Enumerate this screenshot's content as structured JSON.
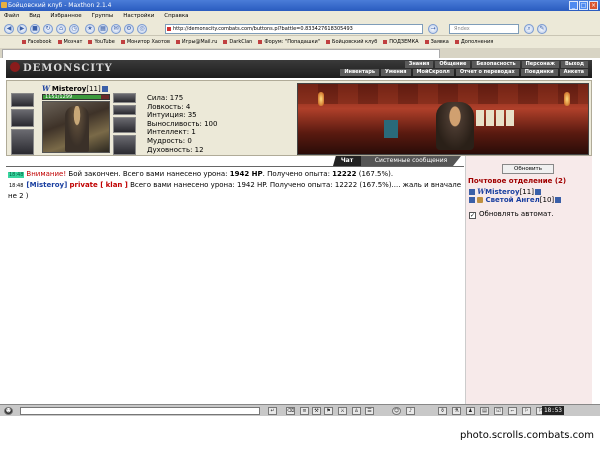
{
  "browser": {
    "title": "Бойцовский клуб - Maxthon 2.1.4",
    "menu": [
      "Файл",
      "Вид",
      "Избранное",
      "Группы",
      "Настройки",
      "Справка"
    ],
    "address": "http://demonscity.combats.com/buttons.pl?battle=0.833427618305493",
    "search_placeholder": "Яndex",
    "bookmarks": [
      "Facebook",
      "Мозчат",
      "YouTube",
      "Монитор Хаотов",
      "Игры@Mail.ru",
      "DarkClan",
      "Форум: \"Попадашки\"",
      "Бойцовский клуб",
      "ПОДЗЕМКА",
      "Заявка",
      "Дополнения"
    ]
  },
  "game": {
    "logo": "DEMONSCITY",
    "nav_row1": [
      "Знания",
      "Общение",
      "Безопасность",
      "Персонаж",
      "Выход"
    ],
    "nav_row2": [
      "Инвентарь",
      "Умения",
      "МойСкролл",
      "Отчет о переводах",
      "Поединки",
      "Анкета"
    ]
  },
  "character": {
    "name": "Misteroy",
    "level": "[11]",
    "hp_text": "1151/1299",
    "hp_fraction": 0.886,
    "stats": [
      "Сила: 175",
      "Ловкость: 4",
      "Интуиция: 35",
      "Выносливость: 100",
      "Интеллект: 1",
      "Мудрость: 0",
      "Духовность: 12"
    ]
  },
  "chat_tabs": {
    "chat": "Чат",
    "system": "Системные сообщения"
  },
  "chat": {
    "line1": {
      "time": "18:48",
      "warn": "Внимание!",
      "text_a": " Бой закончен. Всего вами нанесено урона: ",
      "dmg": "1942 HP",
      "text_b": ". Получено опыта: ",
      "exp": "12222",
      "text_c": " (167.5%)."
    },
    "line2": {
      "time": "18:48",
      "nick": "[Misteroy]",
      "private": "private [",
      "clan": "klan",
      "private_end": "]",
      "text": " Всего вами нанесено урона: 1942 HP. Получено опыта: 12222 (167.5%).... жаль и вначале не 2 )"
    }
  },
  "right_panel": {
    "refresh": "Обновить",
    "room": "Почтовое отделение (2)",
    "users": [
      {
        "name": "Misteroy",
        "level": "[11]"
      },
      {
        "name": "Светой Ангел",
        "level": "[10]"
      }
    ],
    "auto_refresh": "Обновлять автомат.",
    "auto_checked": "✓"
  },
  "bottom": {
    "clock": "18:53"
  },
  "watermark": "photo.scrolls.combats.com"
}
